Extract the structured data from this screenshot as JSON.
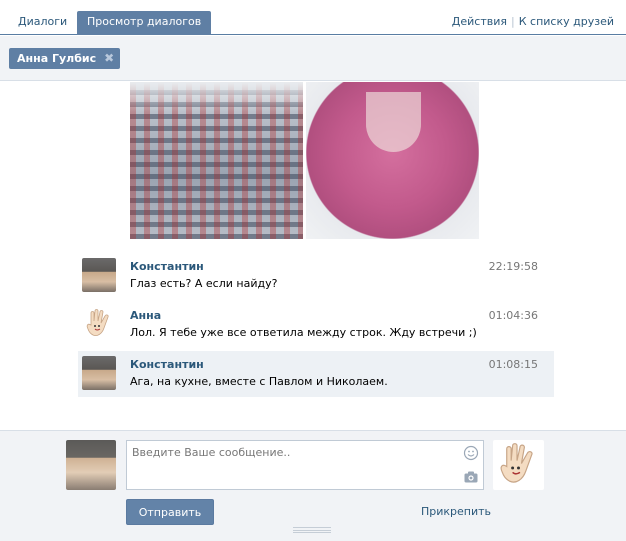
{
  "tabs": {
    "dialogs": "Диалоги",
    "view_dialogs": "Просмотр диалогов"
  },
  "top_links": {
    "actions": "Действия",
    "sep": "|",
    "to_friends": "К списку друзей"
  },
  "filter": {
    "chip_label": "Анна Гулбис",
    "chip_close": "✖"
  },
  "messages": [
    {
      "author": "Константин",
      "time": "22:19:58",
      "text": "Глаз есть? А если найду?",
      "highlighted": false
    },
    {
      "author": "Анна",
      "time": "01:04:36",
      "text": "Лол. Я тебе уже все ответила между строк. Жду встречи ;)",
      "highlighted": false
    },
    {
      "author": "Константин",
      "time": "01:08:15",
      "text": "Ага, на кухне, вместе с Павлом и Николаем.",
      "highlighted": true
    }
  ],
  "composer": {
    "placeholder": "Введите Ваше сообщение..",
    "send_label": "Отправить",
    "attach_label": "Прикрепить"
  },
  "colors": {
    "accent": "#5f7fa4",
    "link": "#2b587a",
    "highlight_row": "#edf1f5"
  }
}
